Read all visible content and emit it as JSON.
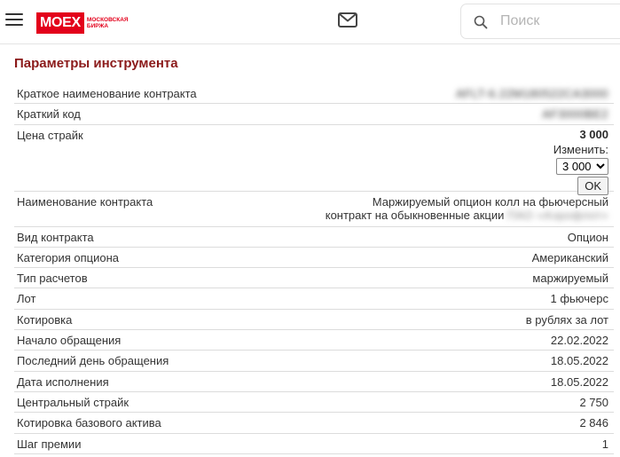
{
  "header": {
    "logo_main": "MOEX",
    "logo_sub_line1": "МОСКОВСКАЯ",
    "logo_sub_line2": "БИРЖА",
    "search_placeholder": "Поиск"
  },
  "page_title": "Параметры инструмента",
  "rows": {
    "short_name": {
      "label": "Краткое наименование контракта",
      "value": "AFLT-6.22M180522CA3000"
    },
    "short_code": {
      "label": "Краткий код",
      "value": "AF3000BE2"
    },
    "strike": {
      "label": "Цена страйк",
      "value": "3 000",
      "change_label": "Изменить:",
      "selected_option": "3 000",
      "ok_label": "OK"
    },
    "contract_name": {
      "label": "Наименование контракта",
      "value_line1": "Маржируемый опцион колл на фьючерсный",
      "value_line2": "контракт на обыкновенные акции",
      "value_hidden": "ПАО «Аэрофлот»"
    },
    "contract_type": {
      "label": "Вид контракта",
      "value": "Опцион"
    },
    "option_category": {
      "label": "Категория опциона",
      "value": "Американский"
    },
    "settlement_type": {
      "label": "Тип расчетов",
      "value": "маржируемый"
    },
    "lot": {
      "label": "Лот",
      "value": "1 фьючерс"
    },
    "quotation": {
      "label": "Котировка",
      "value": "в рублях за лот"
    },
    "trading_start": {
      "label": "Начало обращения",
      "value": "22.02.2022"
    },
    "last_trading_day": {
      "label": "Последний день обращения",
      "value": "18.05.2022"
    },
    "execution_date": {
      "label": "Дата исполнения",
      "value": "18.05.2022"
    },
    "central_strike": {
      "label": "Центральный страйк",
      "value": "2 750"
    },
    "underlying_quote": {
      "label": "Котировка базового актива",
      "value": "2 846"
    },
    "premium_step": {
      "label": "Шаг премии",
      "value": "1"
    }
  }
}
